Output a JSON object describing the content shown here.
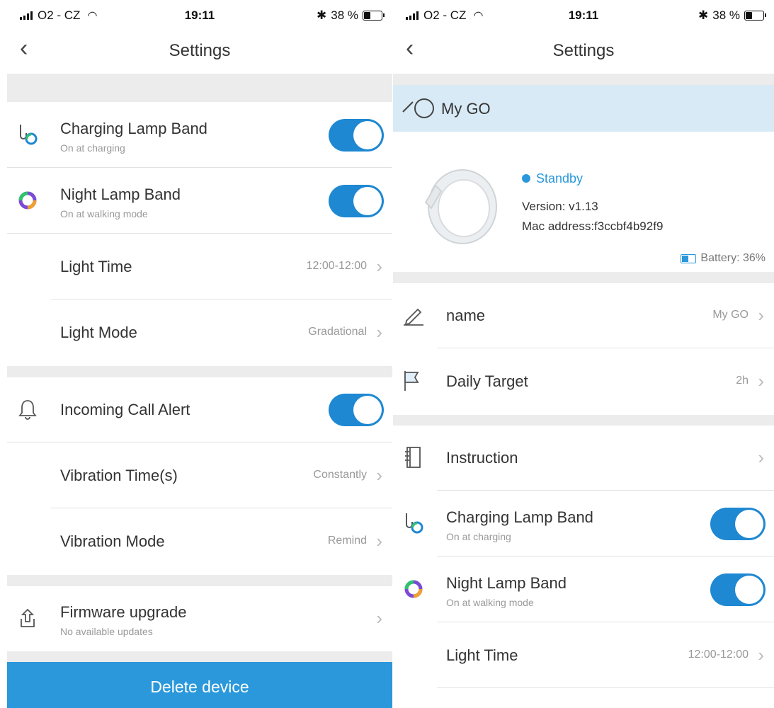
{
  "status": {
    "carrier": "O2 - CZ",
    "time": "19:11",
    "battery_text": "38 %"
  },
  "nav": {
    "title": "Settings"
  },
  "left": {
    "charging": {
      "label": "Charging Lamp Band",
      "sub": "On at charging"
    },
    "night": {
      "label": "Night Lamp Band",
      "sub": "On at walking mode"
    },
    "light_time": {
      "label": "Light Time",
      "value": "12:00-12:00"
    },
    "light_mode": {
      "label": "Light Mode",
      "value": "Gradational"
    },
    "call_alert": {
      "label": "Incoming Call Alert"
    },
    "vib_time": {
      "label": "Vibration Time(s)",
      "value": "Constantly"
    },
    "vib_mode": {
      "label": "Vibration Mode",
      "value": "Remind"
    },
    "firmware": {
      "label": "Firmware upgrade",
      "sub": "No available updates"
    },
    "delete_label": "Delete device"
  },
  "right": {
    "device_name": "My GO",
    "status": "Standby",
    "version": "Version: v1.13",
    "mac": "Mac address:f3ccbf4b92f9",
    "battery": "Battery: 36%",
    "name_row": {
      "label": "name",
      "value": "My GO"
    },
    "target_row": {
      "label": "Daily Target",
      "value": "2h"
    },
    "instruction": {
      "label": "Instruction"
    },
    "charging": {
      "label": "Charging Lamp Band",
      "sub": "On at charging"
    },
    "night": {
      "label": "Night Lamp Band",
      "sub": "On at walking mode"
    },
    "light_time": {
      "label": "Light Time",
      "value": "12:00-12:00"
    }
  },
  "colors": {
    "accent": "#1e88d2",
    "header_bg": "#d8eaf6",
    "band": "#ececec"
  }
}
